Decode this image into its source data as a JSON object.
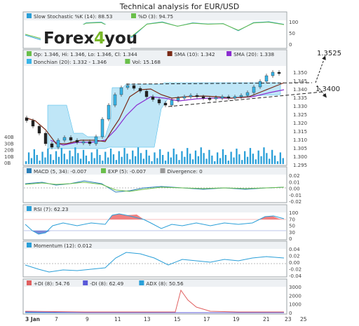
{
  "title": "Technical analysis for EUR/USD",
  "brand": {
    "text_main": "Forex",
    "text_digit": "4",
    "text_end": "you"
  },
  "colors": {
    "panel_bg": "#ffffff",
    "panel_border": "#9aa0a6",
    "legend_bg": "#eef1f4",
    "up_candle": "#39b5e8",
    "down_candle": "#222222",
    "sma10": "#7a2a16",
    "sma20": "#8a2bd0",
    "donchian_fill": "#bfe6f7",
    "volume": "#2a9fd8",
    "macd_line": "#2a7fb8",
    "exp_line": "#6abf4b",
    "rsi_line": "#2a9fd8",
    "overbought_fill": "#f08080",
    "oversold_fill": "#7a8ad8",
    "momentum_line": "#2a9fd8",
    "plus_di": "#e06060",
    "minus_di": "#5a5ad8",
    "adx": "#2a9fd8",
    "stoch_k": "#2a9fd8",
    "stoch_d": "#6abf4b",
    "logo_green": "#79b829"
  },
  "x_labels": [
    "3 Jan",
    "7",
    "9",
    "11",
    "13",
    "15",
    "17",
    "19",
    "21",
    "23",
    "25"
  ],
  "panels": {
    "stoch": {
      "legend": [
        {
          "text": "Slow Stochastic %K (14): 88.53",
          "color": "#2a9fd8"
        },
        {
          "text": "%D (3): 94.75",
          "color": "#6abf4b"
        }
      ],
      "ticks": [
        "100",
        "50",
        "0"
      ]
    },
    "price": {
      "legend_row1": [
        {
          "text": "Op: 1.346, Hi: 1.346, Lo: 1.346, Cl: 1.344",
          "color": "#6abf4b"
        },
        {
          "text": "SMA (10): 1.342",
          "color": "#7a2a16"
        },
        {
          "text": "SMA (20): 1.338",
          "color": "#8a2bd0"
        }
      ],
      "legend_row2": [
        {
          "text": "Donchian (20): 1.332 - 1.346",
          "color": "#39b5e8"
        },
        {
          "text": "Vol: 15.168",
          "color": "#6abf4b"
        }
      ],
      "ticks": [
        "1.350",
        "1.345",
        "1.340",
        "1.335",
        "1.330",
        "1.325",
        "1.320",
        "1.315",
        "1.310",
        "1.305",
        "1.300",
        "1.295"
      ],
      "vol_ticks": [
        "40B",
        "30B",
        "20B",
        "10B",
        "0B"
      ],
      "annotations": {
        "target_high": "1.3525",
        "resistance": "1.3400"
      }
    },
    "macd": {
      "legend": [
        {
          "text": "MACD (5, 34): -0.007",
          "color": "#2a7fb8"
        },
        {
          "text": "EXP (5): -0.007",
          "color": "#6abf4b"
        },
        {
          "text": "Divergence: 0",
          "color": "#999999"
        }
      ],
      "ticks": [
        "0.02",
        "0.01",
        "0.00",
        "-0.01",
        "-0.02"
      ]
    },
    "rsi": {
      "legend": [
        {
          "text": "RSI (7): 62.23",
          "color": "#2a9fd8"
        }
      ],
      "ticks": [
        "100",
        "70",
        "50",
        "30",
        "0"
      ]
    },
    "momentum": {
      "legend": [
        {
          "text": "Momentum (12): 0.012",
          "color": "#2a9fd8"
        }
      ],
      "ticks": [
        "0.04",
        "0.02",
        "0.00",
        "-0.02",
        "-0.04"
      ]
    },
    "dmi": {
      "legend": [
        {
          "text": "+DI (8): 54.76",
          "color": "#e06060"
        },
        {
          "text": "-DI (8): 62.49",
          "color": "#5a5ad8"
        },
        {
          "text": "ADX (8): 50.56",
          "color": "#2a9fd8"
        }
      ],
      "ticks": [
        "3000",
        "2000",
        "1000",
        "0"
      ]
    }
  },
  "chart_data": {
    "type": "line",
    "instrument": "EUR/USD",
    "x": [
      "3 Jan",
      "7",
      "9",
      "11",
      "13",
      "15",
      "17",
      "19",
      "21",
      "23",
      "25"
    ],
    "ohlc_close_approx": [
      1.318,
      1.304,
      1.309,
      1.308,
      1.305,
      1.326,
      1.336,
      1.339,
      1.338,
      1.33,
      1.336,
      1.335,
      1.334,
      1.335,
      1.334,
      1.335,
      1.34,
      1.344
    ],
    "sma10_last": 1.342,
    "sma20_last": 1.338,
    "donchian_range": [
      1.332,
      1.346
    ],
    "price_ylim": [
      1.295,
      1.352
    ],
    "volume_ylim_B": [
      0,
      40
    ],
    "indicators": {
      "stoch_k": 88.53,
      "stoch_d": 94.75,
      "macd": -0.007,
      "macd_exp": -0.007,
      "macd_div": 0,
      "rsi": 62.23,
      "momentum": 0.012,
      "plus_di": 54.76,
      "minus_di": 62.49,
      "adx": 50.56
    },
    "series": [
      {
        "name": "Slow Stochastic %K (14)",
        "values": [
          40,
          20,
          10,
          55,
          95,
          98,
          60,
          30,
          90,
          99,
          80,
          95,
          90,
          92,
          60,
          96,
          100,
          88
        ]
      },
      {
        "name": "RSI (7)",
        "values": [
          45,
          30,
          40,
          35,
          40,
          75,
          78,
          62,
          55,
          40,
          58,
          50,
          55,
          52,
          60,
          66,
          75,
          62
        ]
      },
      {
        "name": "Momentum (12)",
        "values": [
          -0.02,
          -0.03,
          -0.02,
          -0.02,
          -0.015,
          0.005,
          0.02,
          0.02,
          0.015,
          0.0,
          0.012,
          0.008,
          0.01,
          0.005,
          0.012,
          0.014,
          0.015,
          0.012
        ]
      },
      {
        "name": "ADX (8)",
        "values": [
          60,
          50,
          40,
          40,
          35,
          30,
          40,
          45,
          50,
          50,
          45,
          60,
          2500,
          800,
          400,
          200,
          100,
          50
        ]
      }
    ]
  }
}
